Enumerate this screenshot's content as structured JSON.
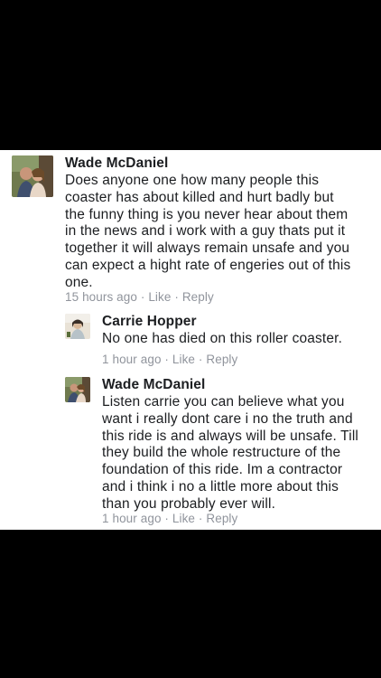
{
  "comments": [
    {
      "author": "Wade McDaniel",
      "lines": [
        "Does anyone one how many people this",
        "coaster has about killed and hurt badly but",
        "the funny thing is you never hear about them",
        "in the news and i work with a guy thats put it",
        "together it will always remain unsafe and you",
        "can expect a hight rate of engeries out of this",
        "one."
      ],
      "time": "15 hours ago",
      "sep": " · ",
      "like": "Like",
      "reply": "Reply"
    },
    {
      "author": "Carrie Hopper",
      "lines": [
        "No one has died on this roller coaster."
      ],
      "time": "1 hour ago",
      "sep": " · ",
      "like": "Like",
      "reply": "Reply"
    },
    {
      "author": "Wade McDaniel",
      "lines": [
        "Listen carrie you can believe what you",
        "want i really dont care i no the truth and",
        "this ride is and always will be unsafe. Till",
        "they build the whole restructure of the",
        "foundation of this ride. Im a contractor",
        "and i think i no a little more about this",
        "than you probably ever will."
      ],
      "time": "1 hour ago",
      "sep": " · ",
      "like": "Like",
      "reply": "Reply"
    }
  ]
}
